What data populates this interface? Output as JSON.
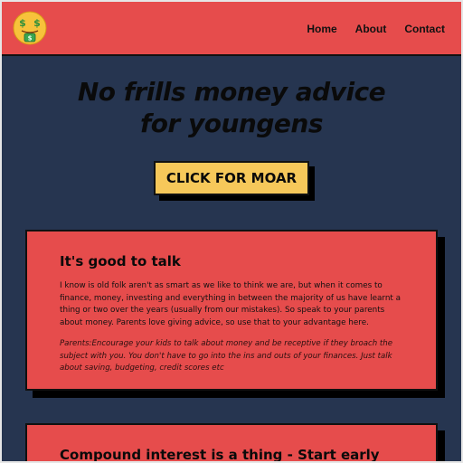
{
  "header": {
    "logo_icon": "money-mouth-face-icon",
    "nav": [
      {
        "label": "Home"
      },
      {
        "label": "About"
      },
      {
        "label": "Contact"
      }
    ]
  },
  "hero": {
    "title_line1": "No frills money advice",
    "title_line2": "for youngens",
    "cta_label": "CLICK FOR MOAR"
  },
  "cards": [
    {
      "title": "It's good to talk",
      "body": "I know is old folk aren't as smart as we like to think we are, but when it comes to finance, money, investing and everything in between the majority of us have learnt a thing or two over the years (usually from our mistakes). So speak to your parents about money. Parents love giving advice, so use that to your advantage here.",
      "note": "Parents:Encourage your kids to talk about money and be receptive if they broach the subject with you. You don't have to go into the ins and outs of your finances. Just talk about saving, budgeting, credit scores etc"
    },
    {
      "title": "Compound interest is a thing - Start early"
    }
  ],
  "colors": {
    "background": "#263550",
    "accent_red": "#e64c4c",
    "cta_yellow": "#f6c85a"
  }
}
